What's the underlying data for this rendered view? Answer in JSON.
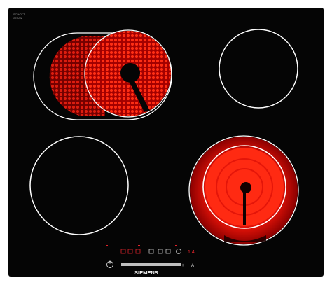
{
  "appliance": {
    "brand": "SIEMENS",
    "glass_badge": "SCHOTT CERAN",
    "glass_badge_short": "SCHOTT",
    "glass_badge_sub": "CERAN"
  },
  "control_panel": {
    "power_symbol": "⏻",
    "minus_symbol": "−",
    "plus_symbol": "+",
    "auto_symbol": "A",
    "timer_display": "1 4",
    "slider_label": "touch slider"
  },
  "zones": [
    {
      "name": "dual-oval-zone",
      "state": "on"
    },
    {
      "name": "rear-right-zone",
      "state": "off"
    },
    {
      "name": "front-left-zone",
      "state": "off"
    },
    {
      "name": "front-right-dual-zone",
      "state": "on"
    }
  ],
  "colors": {
    "glass": "#060606",
    "heating": "#ff1a0d",
    "heating_glow": "#b30000",
    "zone_outline": "#ffffff",
    "indicator": "#e0242b",
    "slider": "#bfbfbf"
  }
}
